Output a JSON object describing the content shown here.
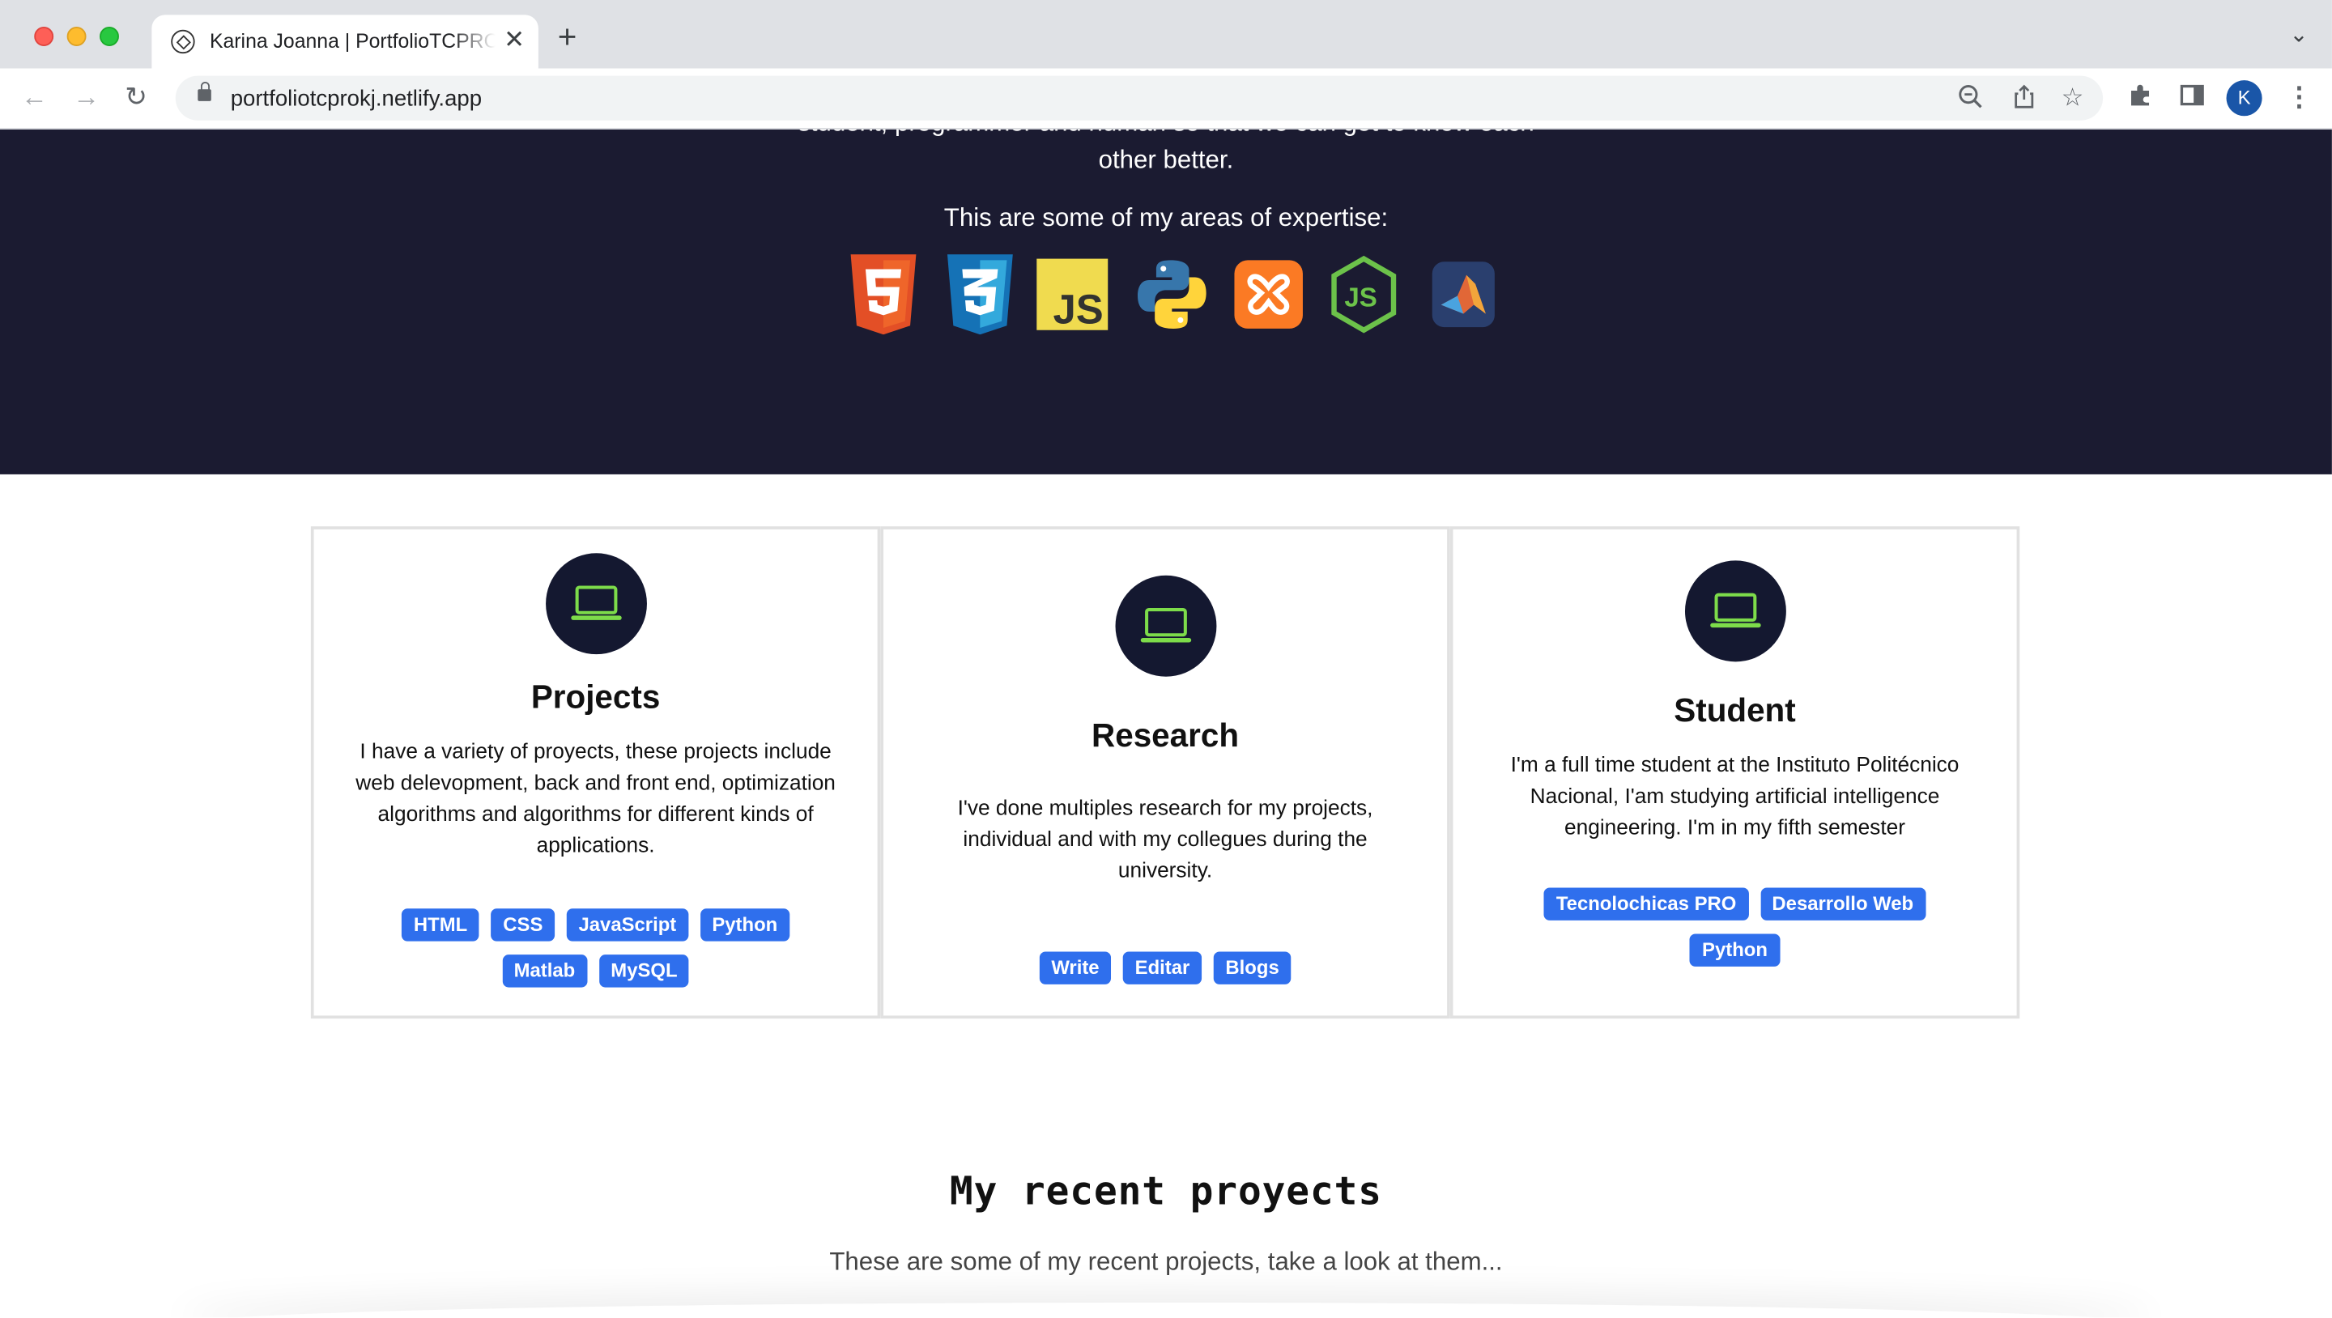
{
  "browser": {
    "tab_title": "Karina Joanna | PortfolioTCPRO",
    "tab_close": "✕",
    "new_tab": "+",
    "url": "portfoliotcprokj.netlify.app",
    "profile_initial": "K"
  },
  "hero": {
    "cut_line": "student, programmer and human so that we can get to know each",
    "line2": "other better.",
    "expertise_label": "This are some of my areas of expertise:",
    "tech_icons": [
      "html5-icon",
      "css3-icon",
      "javascript-icon",
      "python-icon",
      "xampp-icon",
      "nodejs-icon",
      "matlab-icon"
    ],
    "background": "#1b1b31"
  },
  "cards": [
    {
      "title": "Projects",
      "icon": "laptop-icon",
      "description": "I have a variety of proyects, these projects include web delevopment, back and front end, optimization algorithms and algorithms for different kinds of applications.",
      "tags": [
        "HTML",
        "CSS",
        "JavaScript",
        "Python",
        "Matlab",
        "MySQL"
      ]
    },
    {
      "title": "Research",
      "icon": "laptop-icon",
      "description": "I've done multiples research for my projects, individual and with my collegues during the university.",
      "tags": [
        "Write",
        "Editar",
        "Blogs"
      ]
    },
    {
      "title": "Student",
      "icon": "laptop-icon",
      "description": "I'm a full time student at the Instituto Politécnico Nacional, I'am studying artificial intelligence engineering. I'm in my fifth semester",
      "tags": [
        "Tecnolochicas PRO",
        "Desarrollo Web",
        "Python"
      ]
    }
  ],
  "recent": {
    "title": "My recent proyects",
    "subtitle": "These are some of my recent projects, take a look at them..."
  },
  "colors": {
    "accent": "#2f6fed",
    "icon_green": "#7ddc4a",
    "circle": "#141830"
  }
}
